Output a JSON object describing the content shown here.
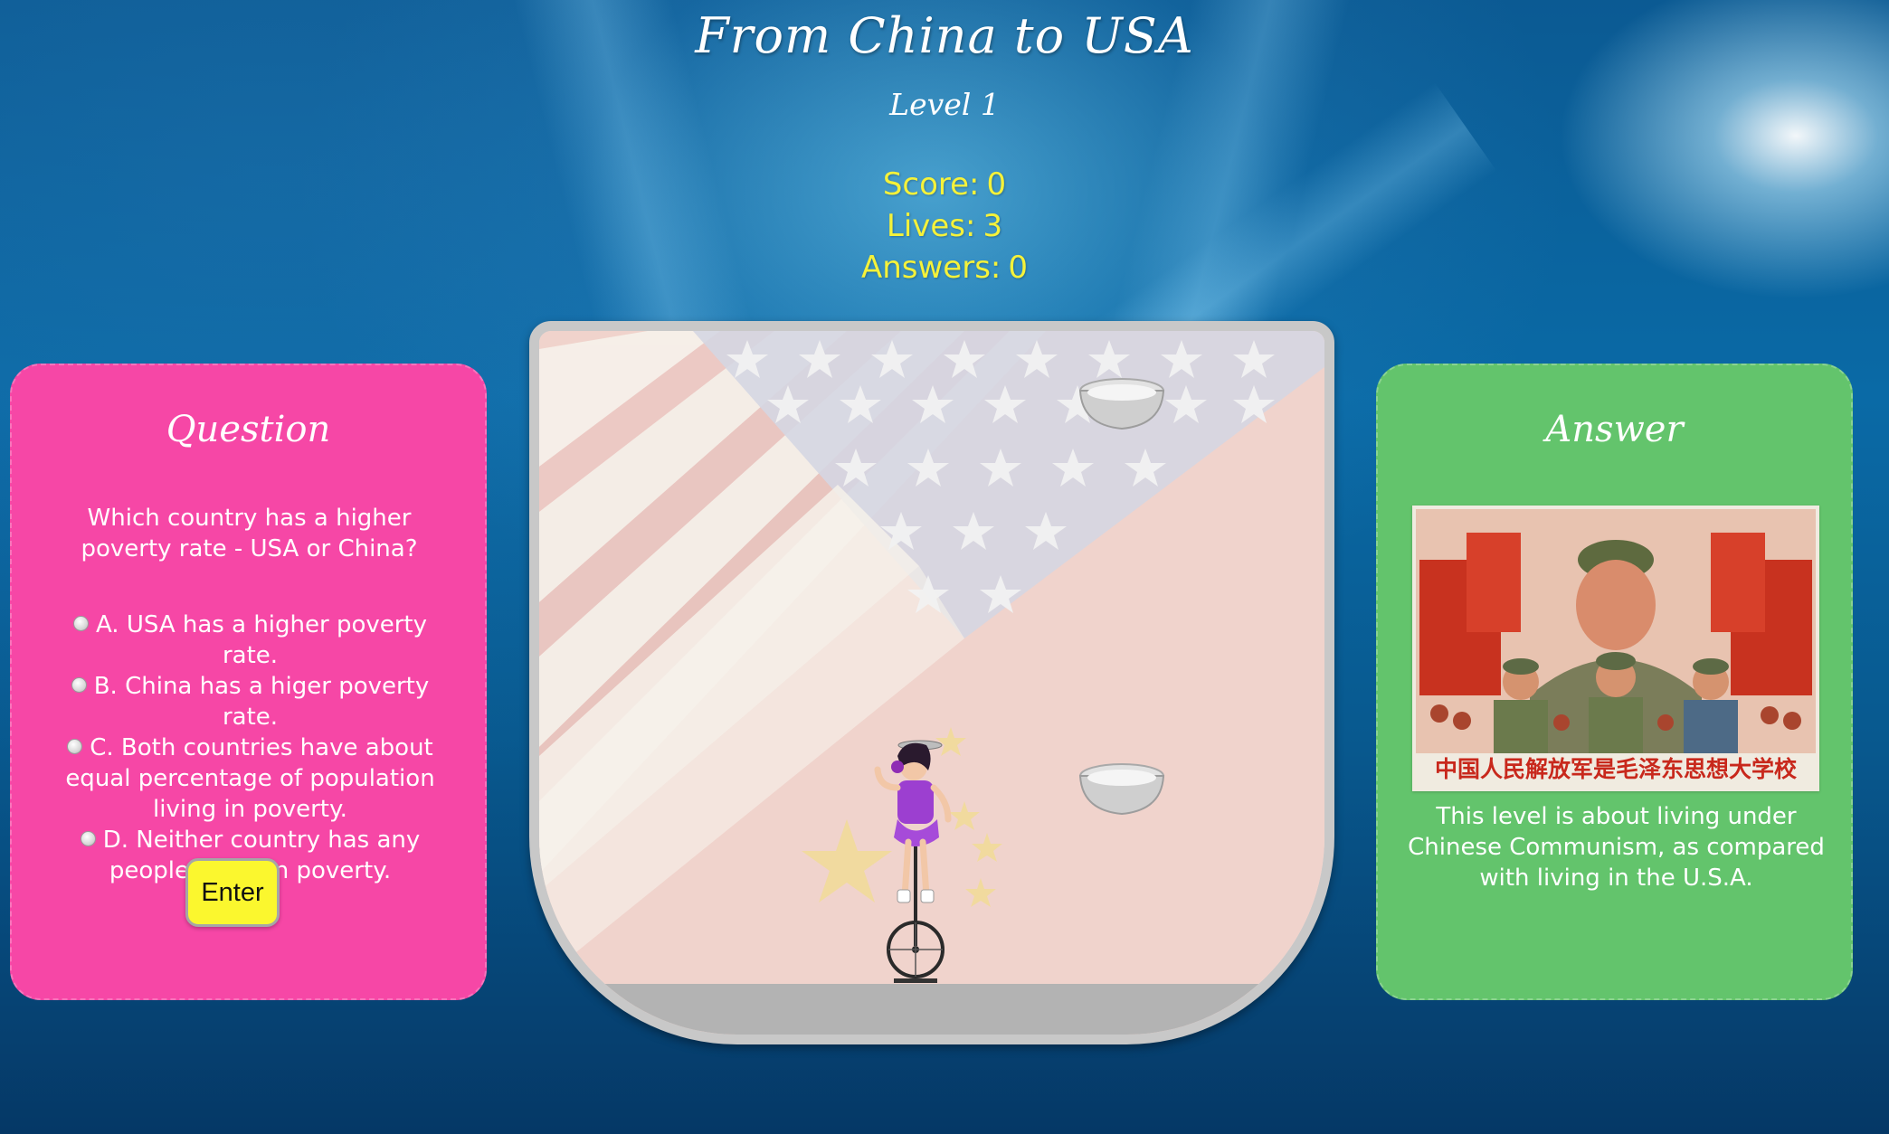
{
  "header": {
    "title": "From China to USA",
    "level": "Level 1"
  },
  "stats": {
    "score_label": "Score:",
    "score_value": "0",
    "lives_label": "Lives:",
    "lives_value": "3",
    "answers_label": "Answers:",
    "answers_value": "0"
  },
  "question_panel": {
    "heading": "Question",
    "question": "Which country has a higher poverty rate - USA or China?",
    "options": [
      "A. USA has a higher poverty rate.",
      "B. China has a higer poverty rate.",
      "C. Both countries have about equal percentage of population living in poverty.",
      "D. Neither country has any people living in poverty."
    ],
    "enter_label": "Enter"
  },
  "answer_panel": {
    "heading": "Answer",
    "poster_text": "中国人民解放军是毛泽东思想大学校",
    "explanation": "This level is about living under Chinese Communism, as compared with living in the U.S.A."
  },
  "game": {
    "objects": [
      "falling-bowl",
      "unicycle-performer"
    ]
  },
  "colors": {
    "question_panel": "#f647a6",
    "answer_panel": "#63c46c",
    "stats_text": "#f5f23a",
    "enter_button": "#fbf72e"
  }
}
